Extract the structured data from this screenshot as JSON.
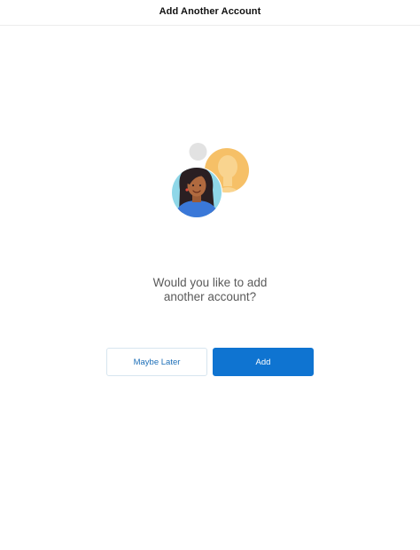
{
  "header": {
    "title": "Add Another Account"
  },
  "illustration": {
    "icon": "accounts-illustration-icon"
  },
  "prompt": {
    "line1": "Would you like to add",
    "line2": "another account?"
  },
  "buttons": {
    "maybe_later_label": "Maybe Later",
    "add_label": "Add"
  },
  "colors": {
    "primary": "#0f74d1",
    "secondary_border": "#d7e5ef",
    "prompt_text": "#5a5a5a"
  }
}
